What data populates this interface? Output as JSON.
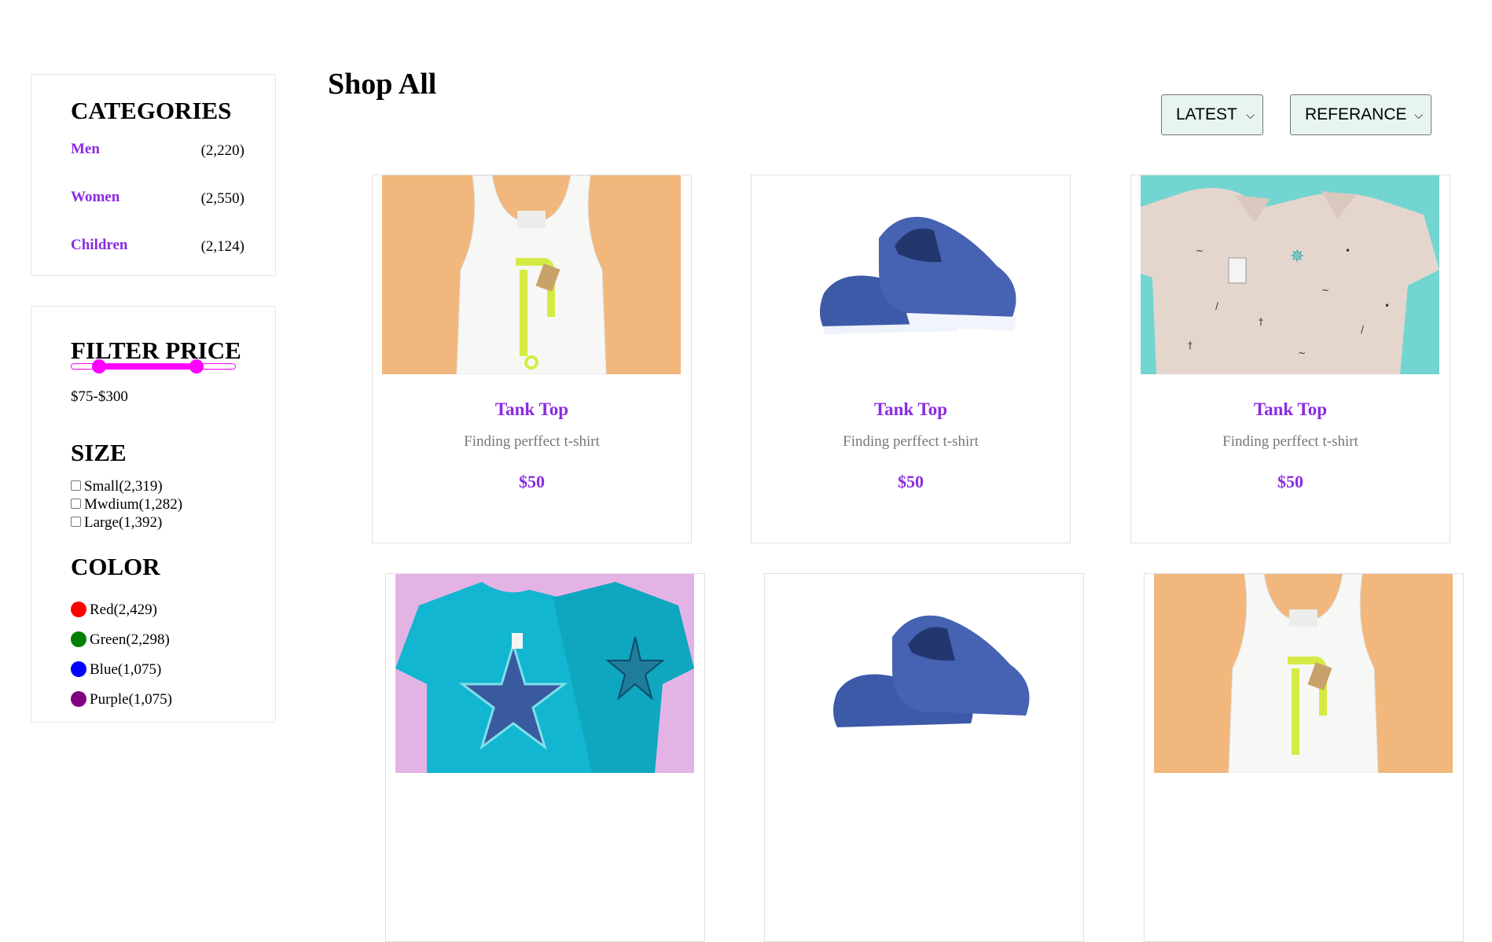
{
  "page_title": "Shop All",
  "categories": {
    "heading": "CATEGORIES",
    "items": [
      {
        "label": "Men",
        "count": "(2,220)"
      },
      {
        "label": "Women",
        "count": "(2,550)"
      },
      {
        "label": "Children",
        "count": "(2,124)"
      }
    ]
  },
  "filter_price": {
    "heading": "FILTER PRICE",
    "range_text": "$75-$300",
    "range_low_fraction": 0.17,
    "range_high_fraction": 0.76
  },
  "size": {
    "heading": "SIZE",
    "options": [
      {
        "label": "Small(2,319)",
        "checked": false
      },
      {
        "label": "Mwdium(1,282)",
        "checked": false
      },
      {
        "label": "Large(1,392)",
        "checked": false
      }
    ]
  },
  "color": {
    "heading": "COLOR",
    "options": [
      {
        "label": "Red(2,429)",
        "swatch": "#ff0000"
      },
      {
        "label": "Green(2,298)",
        "swatch": "#008000"
      },
      {
        "label": "Blue(1,075)",
        "swatch": "#0000ff"
      },
      {
        "label": "Purple(1,075)",
        "swatch": "#800080"
      }
    ]
  },
  "sort": {
    "latest": "LATEST",
    "reference": "REFERANCE"
  },
  "colors": {
    "accent": "#8a2be2",
    "slider": "#ff00ff",
    "select_bg": "#e8f5ee"
  },
  "products": [
    {
      "title": "Tank Top",
      "desc": "Finding perffect t-shirt",
      "price": "$50",
      "image": "white-tank-top-on-orange"
    },
    {
      "title": "Tank Top",
      "desc": "Finding perffect t-shirt",
      "price": "$50",
      "image": "blue-sneakers-on-white"
    },
    {
      "title": "Tank Top",
      "desc": "Finding perffect t-shirt",
      "price": "$50",
      "image": "beige-polo-shirts-on-teal"
    },
    {
      "title": "",
      "desc": "",
      "price": "",
      "image": "cyan-star-tshirts-on-pink"
    },
    {
      "title": "",
      "desc": "",
      "price": "",
      "image": "blue-sneakers-on-white"
    },
    {
      "title": "",
      "desc": "",
      "price": "",
      "image": "white-tank-top-on-orange"
    }
  ]
}
